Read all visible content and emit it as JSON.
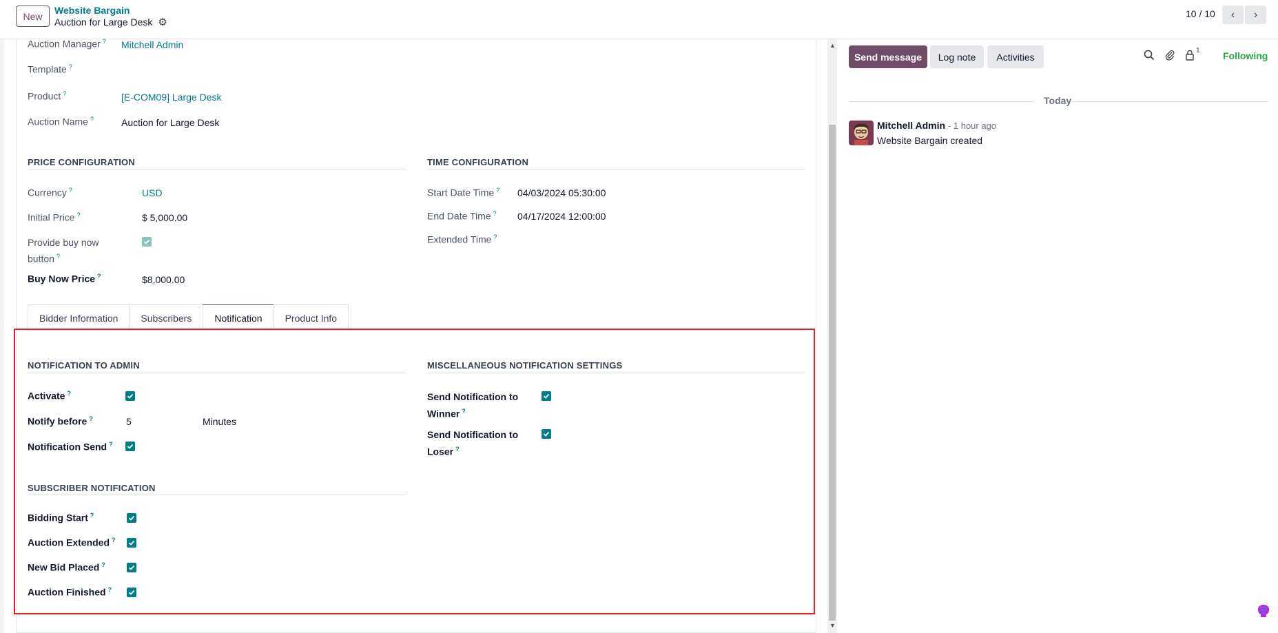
{
  "topbar": {
    "new_label": "New",
    "breadcrumb_parent": "Website Bargain",
    "breadcrumb_current": "Auction for Large Desk",
    "pager": "10 / 10"
  },
  "general": {
    "auction_manager_label": "Auction Manager",
    "auction_manager_value": "Mitchell Admin",
    "template_label": "Template",
    "product_label": "Product",
    "product_value": "[E-COM09] Large Desk",
    "auction_name_label": "Auction Name",
    "auction_name_value": "Auction for Large Desk"
  },
  "price": {
    "title": "PRICE CONFIGURATION",
    "currency_label": "Currency",
    "currency_value": "USD",
    "initial_price_label": "Initial Price",
    "initial_price_value": "$ 5,000.00",
    "buy_now_label_1": "Provide buy now",
    "buy_now_label_2": "button",
    "buy_now_checked": true,
    "buy_now_price_label": "Buy Now Price",
    "buy_now_price_value": "$8,000.00"
  },
  "time": {
    "title": "TIME CONFIGURATION",
    "start_label": "Start Date Time",
    "start_value": "04/03/2024 05:30:00",
    "end_label": "End Date Time",
    "end_value": "04/17/2024 12:00:00",
    "extended_label": "Extended Time"
  },
  "tabs": [
    "Bidder Information",
    "Subscribers",
    "Notification",
    "Product Info"
  ],
  "active_tab": "Notification",
  "notification_admin": {
    "title": "NOTIFICATION TO ADMIN",
    "activate_label": "Activate",
    "notify_before_label": "Notify before",
    "notify_before_value": "5",
    "notify_before_unit": "Minutes",
    "notification_send_label": "Notification Send"
  },
  "misc": {
    "title": "MISCELLANEOUS NOTIFICATION SETTINGS",
    "winner_label_1": "Send Notification to",
    "winner_label_2": "Winner",
    "loser_label_1": "Send Notification to",
    "loser_label_2": "Loser"
  },
  "subscriber": {
    "title": "SUBSCRIBER NOTIFICATION",
    "bidding_start_label": "Bidding Start",
    "auction_extended_label": "Auction Extended",
    "new_bid_label": "New Bid Placed",
    "auction_finished_label": "Auction Finished"
  },
  "chatter": {
    "send_message": "Send message",
    "log_note": "Log note",
    "activities": "Activities",
    "follower_count": "1",
    "following": "Following",
    "today": "Today",
    "author": "Mitchell Admin",
    "time": "- 1 hour ago",
    "message": "Website Bargain created"
  },
  "question_mark": "?",
  "colors": {
    "primary": "#714b67",
    "link": "#017e84",
    "following": "#28a745",
    "highlight": "#e11d2e"
  }
}
